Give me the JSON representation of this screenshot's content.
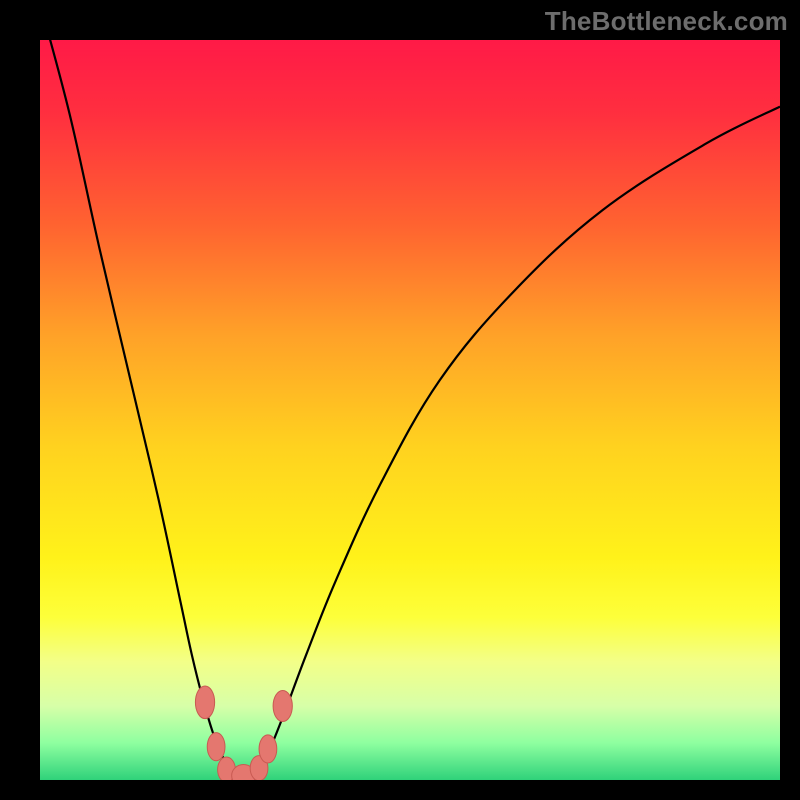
{
  "watermark": "TheBottleneck.com",
  "colors": {
    "black": "#000000",
    "curve": "#000000",
    "marker_fill": "#e4776f",
    "marker_stroke": "#c85a52"
  },
  "chart_data": {
    "type": "line",
    "title": "",
    "xlabel": "",
    "ylabel": "",
    "xlim": [
      0,
      100
    ],
    "ylim": [
      0,
      100
    ],
    "grid": false,
    "legend": false,
    "gradient_stops": [
      {
        "offset": 0.0,
        "color": "#ff1a47"
      },
      {
        "offset": 0.1,
        "color": "#ff2f3f"
      },
      {
        "offset": 0.25,
        "color": "#ff6330"
      },
      {
        "offset": 0.4,
        "color": "#ffa228"
      },
      {
        "offset": 0.55,
        "color": "#ffd21f"
      },
      {
        "offset": 0.7,
        "color": "#fff21a"
      },
      {
        "offset": 0.78,
        "color": "#fdff3a"
      },
      {
        "offset": 0.84,
        "color": "#f3ff88"
      },
      {
        "offset": 0.9,
        "color": "#d7ffa8"
      },
      {
        "offset": 0.95,
        "color": "#8effa0"
      },
      {
        "offset": 1.0,
        "color": "#2fd27a"
      }
    ],
    "series": [
      {
        "name": "bottleneck-curve",
        "x": [
          0,
          4,
          8,
          12,
          16,
          19,
          20.5,
          22,
          23.5,
          25,
          26,
          27,
          28,
          29,
          30,
          31,
          33,
          36,
          40,
          46,
          54,
          64,
          76,
          90,
          100
        ],
        "y": [
          105,
          90,
          72,
          55,
          38,
          24,
          17,
          11,
          6,
          2.5,
          1.0,
          0.5,
          0.5,
          1.0,
          2.0,
          4.0,
          9,
          17,
          27,
          40,
          54,
          66,
          77,
          86,
          91
        ]
      }
    ],
    "markers": [
      {
        "x": 22.3,
        "y": 10.5,
        "rx": 1.3,
        "ry": 2.2
      },
      {
        "x": 23.8,
        "y": 4.5,
        "rx": 1.2,
        "ry": 1.9
      },
      {
        "x": 25.2,
        "y": 1.4,
        "rx": 1.2,
        "ry": 1.7
      },
      {
        "x": 27.5,
        "y": 0.6,
        "rx": 1.6,
        "ry": 1.5
      },
      {
        "x": 29.6,
        "y": 1.6,
        "rx": 1.2,
        "ry": 1.7
      },
      {
        "x": 30.8,
        "y": 4.2,
        "rx": 1.2,
        "ry": 1.9
      },
      {
        "x": 32.8,
        "y": 10.0,
        "rx": 1.3,
        "ry": 2.1
      }
    ]
  }
}
